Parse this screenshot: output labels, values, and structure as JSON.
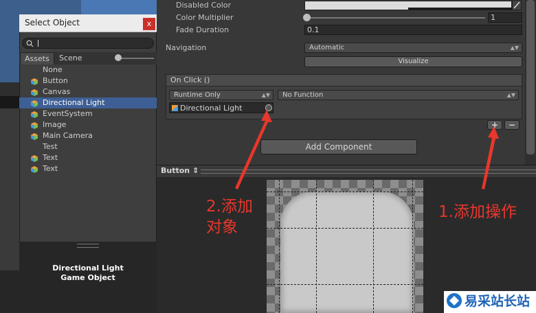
{
  "inspector": {
    "disabled_color_label": "Disabled Color",
    "color_multiplier_label": "Color Multiplier",
    "color_multiplier_value": "1",
    "fade_duration_label": "Fade Duration",
    "fade_duration_value": "0.1",
    "navigation_label": "Navigation",
    "navigation_value": "Automatic",
    "visualize_label": "Visualize",
    "onclick_header": "On Click ()",
    "runtime_value": "Runtime Only",
    "function_value": "No Function",
    "object_value": "Directional Light",
    "add_label": "+",
    "remove_label": "−",
    "add_component_label": "Add Component"
  },
  "preview": {
    "title": "Button",
    "title_arrow": "⇕"
  },
  "dialog": {
    "title": "Select Object",
    "close_label": "x",
    "search_placeholder": "",
    "tabs": [
      {
        "label": "Assets"
      },
      {
        "label": "Scene"
      }
    ],
    "items": [
      {
        "label": "None",
        "icon": "none"
      },
      {
        "label": "Button",
        "icon": "gameobject-cube-icon"
      },
      {
        "label": "Canvas",
        "icon": "gameobject-cube-icon"
      },
      {
        "label": "Directional Light",
        "icon": "gameobject-cube-icon",
        "selected": true
      },
      {
        "label": "EventSystem",
        "icon": "gameobject-cube-icon"
      },
      {
        "label": "Image",
        "icon": "gameobject-cube-icon"
      },
      {
        "label": "Main Camera",
        "icon": "gameobject-cube-icon"
      },
      {
        "label": "Test",
        "icon": "none"
      },
      {
        "label": "Text",
        "icon": "gameobject-cube-icon"
      },
      {
        "label": "Text",
        "icon": "gameobject-cube-icon"
      }
    ],
    "preview_line1": "Directional Light",
    "preview_line2": "Game Object"
  },
  "annotations": {
    "step2_line1": "2.添加",
    "step2_line2": "对象",
    "step1": "1.添加操作",
    "color": "#e8372c"
  },
  "watermark": {
    "text": "易采站长站"
  }
}
